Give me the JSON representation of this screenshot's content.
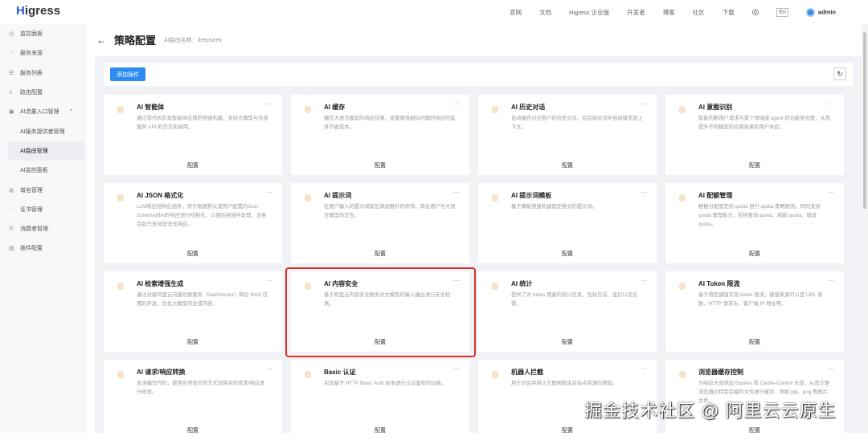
{
  "app": {
    "logo_h": "H",
    "logo_rest": "igress"
  },
  "nav": [
    "官网",
    "文档",
    "Higress 企业版",
    "开发者",
    "博客",
    "社区",
    "下载"
  ],
  "lang": "En",
  "user": "admin",
  "sidebar": [
    {
      "label": "监控面板",
      "icon": "◷"
    },
    {
      "label": "服务来源",
      "icon": "⁙"
    },
    {
      "label": "服务列表",
      "icon": "☰"
    },
    {
      "label": "路由配置",
      "icon": "⅄"
    },
    {
      "label": "AI流量入口管理",
      "icon": "▣"
    },
    {
      "label": "AI服务提供者管理",
      "sub": true
    },
    {
      "label": "AI路由管理",
      "sub": true,
      "active": true
    },
    {
      "label": "AI监控面板",
      "sub": true
    },
    {
      "label": "域名管理",
      "icon": "◍"
    },
    {
      "label": "证书管理",
      "icon": "◌"
    },
    {
      "label": "消费者管理",
      "icon": "ℛ"
    },
    {
      "label": "插件配置",
      "icon": "▤"
    }
  ],
  "page": {
    "title": "策略配置",
    "subtitle": "AI路由名称：deepseek",
    "add_button": "添加插件"
  },
  "config_label": "配置",
  "cards": [
    {
      "title": "AI 智能体",
      "desc": "通过零代码实现智能体应用的快速构建，支持大模型与外部服务 API 的交互和调用。"
    },
    {
      "title": "AI 缓存",
      "desc": "缓存大语言模型的响应结果，显著降低相似问题的响应时延并节省成本。"
    },
    {
      "title": "AI 历史对话",
      "desc": "自动缓存对应用户的历史对话，在后续对话中自动填充到上下文。"
    },
    {
      "title": "AI 意图识别",
      "desc": "智能判断用户请求与某个领域或 agent 的功能契合度，从而提升不同模型的应用效果和用户体验。"
    },
    {
      "title": "AI JSON 格式化",
      "desc": "LLM响应结构化插件，用于根据默认或用户配置的Json Schema对AI的响应进行结构化，以便后续插件处理。注意目前只支持非流式响应。"
    },
    {
      "title": "AI 提示词",
      "desc": "在用户输入的提示词前后添加额外的修饰，简化用户与大语言模型的交互。"
    },
    {
      "title": "AI 提示词模板",
      "desc": "基于模板快速构建固定格式的提示词。"
    },
    {
      "title": "AI 配额管理",
      "desc": "根据分配固定的 quota 进行 quota 策略限流，同时支持 quota 管理能力，包括查询 quota、刷新 quota、增减 quota。"
    },
    {
      "title": "AI 检索增强生成",
      "desc": "通过对接阿里云向量检索服务（DashVector）简化 RAG 应用的开发，优化大模型的生成内容。"
    },
    {
      "title": "AI 内容安全",
      "desc": "基于阿里云内容安全服务对大模型的输入输出进行安全检测。"
    },
    {
      "title": "AI 统计",
      "desc": "提供了对 token 用量的统计信息，包括日志、监控以及告警。"
    },
    {
      "title": "AI Token 限流",
      "desc": "基于特定键值实现 token 限流，键值来源可以是 URL 参数、HTTP 请求头、客户端 IP 地址等。"
    },
    {
      "title": "AI 请求/响应转换",
      "desc": "无须编写代码，使用自然语言的方式对网关的请求/响应进行修改。"
    },
    {
      "title": "Basic 认证",
      "desc": "实现基于 HTTP Basic Auth 标准进行认证鉴权的功能。"
    },
    {
      "title": "机器人拦截",
      "desc": "用于识别并阻止互联网爬虫对站点资源的爬取。"
    },
    {
      "title": "浏览器缓存控制",
      "desc": "为响应头部添加 Expires 和 Cache-Control 头部，从而方便浏览器对特定后缀的文件进行缓存，例如 jpg、png 等图片文件。"
    }
  ],
  "watermark": "掘金技术社区 @ 阿里云云原生"
}
